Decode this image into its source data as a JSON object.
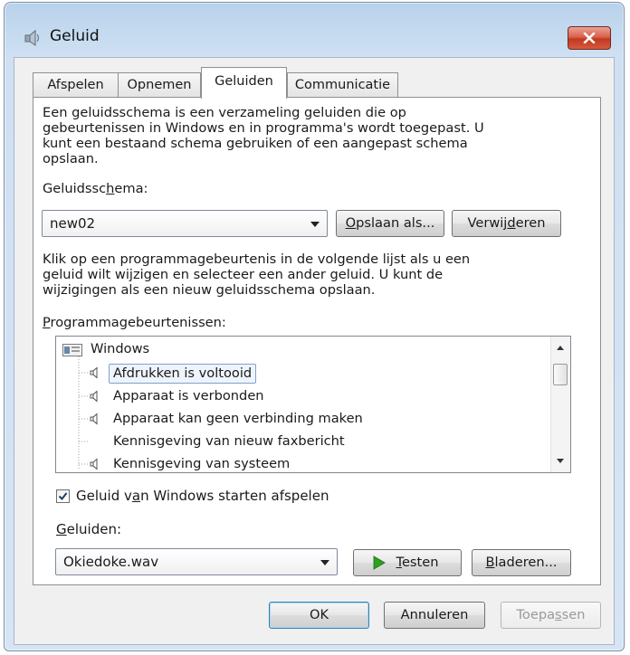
{
  "window": {
    "title": "Geluid",
    "close_label": "X"
  },
  "tabs": [
    {
      "label": "Afspelen"
    },
    {
      "label": "Opnemen"
    },
    {
      "label": "Geluiden"
    },
    {
      "label": "Communicatie"
    }
  ],
  "active_tab": "Geluiden",
  "sounds_tab": {
    "intro_lines": [
      "Een geluidsschema is een verzameling geluiden die op",
      "gebeurtenissen in Windows en in programma's wordt toegepast.  U",
      "kunt een bestaand schema gebruiken of een aangepast schema",
      "opslaan."
    ],
    "scheme_label": {
      "before": "Geluidssc",
      "mnemonic": "h",
      "after": "ema:"
    },
    "scheme_value": "new02",
    "save_as": {
      "mnemonic": "O",
      "rest": "pslaan als..."
    },
    "delete": {
      "before": "Verwij",
      "mnemonic": "d",
      "after": "eren"
    },
    "events_text_lines": [
      "Klik op een programmagebeurtenis in de volgende lijst als u een",
      "geluid wilt wijzigen en selecteer een ander geluid.  U kunt de",
      "wijzigingen als een nieuw geluidsschema opslaan."
    ],
    "events_label": {
      "mnemonic": "P",
      "rest": "rogrammagebeurtenissen:"
    },
    "events": [
      {
        "label": "Windows",
        "type": "group"
      },
      {
        "label": "Afdrukken is voltooid",
        "has_sound": true,
        "selected": true
      },
      {
        "label": "Apparaat is verbonden",
        "has_sound": true
      },
      {
        "label": "Apparaat kan geen verbinding maken",
        "has_sound": true
      },
      {
        "label": "Kennisgeving van nieuw faxbericht",
        "has_sound": false
      },
      {
        "label": "Kennisgeving van systeem",
        "has_sound": true
      }
    ],
    "startup_checkbox": {
      "before": "Geluid v",
      "mnemonic": "a",
      "after": "n Windows starten afspelen",
      "checked": true
    },
    "sounds_label": {
      "mnemonic": "G",
      "rest": "eluiden:"
    },
    "sound_value": "Okiedoke.wav",
    "test": {
      "mnemonic": "T",
      "rest": "esten"
    },
    "browse": {
      "mnemonic": "B",
      "rest": "laderen..."
    }
  },
  "footer": {
    "ok": "OK",
    "cancel": "Annuleren",
    "apply": {
      "before": "Toepa",
      "mnemonic": "s",
      "after": "sen"
    }
  },
  "colors": {
    "play_icon": "#2fa11f",
    "selection_border": "#7da2ce",
    "close_red": "#c3391f"
  }
}
